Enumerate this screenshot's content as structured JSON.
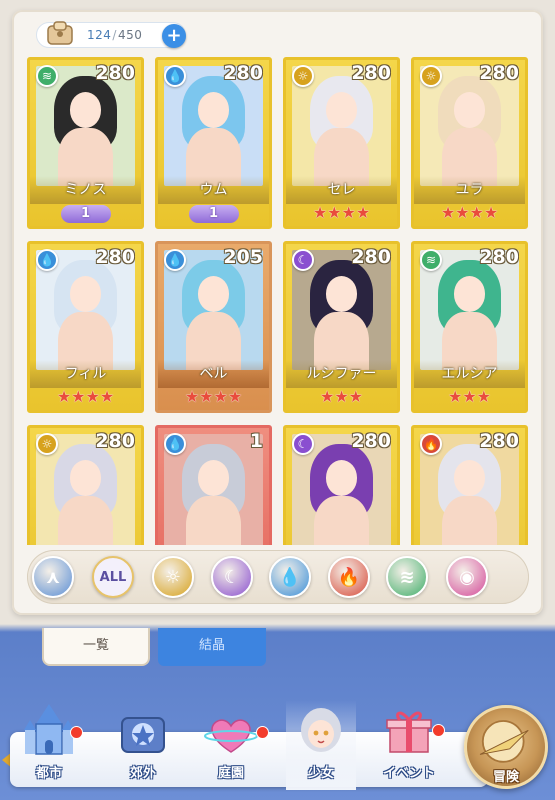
{
  "counter": {
    "current": "124",
    "separator": "/",
    "max": "450",
    "plus": "+"
  },
  "cards": [
    {
      "name": "ミノス",
      "level": "280",
      "element": "wind",
      "badge": "1",
      "stars": "",
      "frame": "gold",
      "hair": "#2a2a2a",
      "bg": "#dbe9c9",
      "elemColor": "#3fae6a",
      "elemGlyph": "≋"
    },
    {
      "name": "ウム",
      "level": "280",
      "element": "water",
      "badge": "1",
      "stars": "",
      "frame": "gold",
      "hair": "#7cc6ee",
      "bg": "#c9def6",
      "elemColor": "#3a8fd9",
      "elemGlyph": "💧"
    },
    {
      "name": "セレ",
      "level": "280",
      "element": "light",
      "badge": "",
      "stars": "★★★★",
      "frame": "gold",
      "hair": "#e8e8ef",
      "bg": "#f4e7a8",
      "elemColor": "#d7a21e",
      "elemGlyph": "☼"
    },
    {
      "name": "ユラ",
      "level": "280",
      "element": "light",
      "badge": "",
      "stars": "★★★★",
      "frame": "gold",
      "hair": "#f0dcbc",
      "bg": "#f5e9b7",
      "elemColor": "#d7a21e",
      "elemGlyph": "☼"
    },
    {
      "name": "フィル",
      "level": "280",
      "element": "water",
      "badge": "",
      "stars": "★★★★",
      "frame": "gold",
      "hair": "#d6e4f2",
      "bg": "#e5eef6",
      "elemColor": "#3a8fd9",
      "elemGlyph": "💧"
    },
    {
      "name": "ベル",
      "level": "205",
      "element": "water",
      "badge": "",
      "stars": "★★★★",
      "frame": "bronze",
      "hair": "#7ccbe8",
      "bg": "#b8d9ef",
      "elemColor": "#3a8fd9",
      "elemGlyph": "💧"
    },
    {
      "name": "ルシファー",
      "level": "280",
      "element": "dark",
      "badge": "",
      "stars": "★★★",
      "frame": "gold",
      "hair": "#2a2440",
      "bg": "#b7a98f",
      "elemColor": "#8a4fd0",
      "elemGlyph": "☾"
    },
    {
      "name": "エルシア",
      "level": "280",
      "element": "wind",
      "badge": "",
      "stars": "★★★",
      "frame": "gold",
      "hair": "#3fb58e",
      "bg": "#e6ebe6",
      "elemColor": "#3fae6a",
      "elemGlyph": "≋"
    },
    {
      "name": "",
      "level": "280",
      "element": "light",
      "badge": "",
      "stars": "",
      "frame": "gold",
      "hair": "#d8d8e6",
      "bg": "#f3e6b0",
      "elemColor": "#d7a21e",
      "elemGlyph": "☼"
    },
    {
      "name": "",
      "level": "1",
      "element": "water",
      "badge": "",
      "stars": "",
      "frame": "red",
      "hair": "#c8ccd8",
      "bg": "#e8b0a6",
      "elemColor": "#3a8fd9",
      "elemGlyph": "💧"
    },
    {
      "name": "",
      "level": "280",
      "element": "dark",
      "badge": "",
      "stars": "",
      "frame": "gold",
      "hair": "#7a3fb0",
      "bg": "#e9d7b6",
      "elemColor": "#8a4fd0",
      "elemGlyph": "☾"
    },
    {
      "name": "",
      "level": "280",
      "element": "fire",
      "badge": "",
      "stars": "",
      "frame": "gold",
      "hair": "#e4e4ec",
      "bg": "#f0d9a0",
      "elemColor": "#d74a3a",
      "elemGlyph": "🔥"
    }
  ],
  "filters": [
    {
      "id": "sort",
      "label": "",
      "color": "#5b8fd6",
      "glyph": "⋏",
      "icon": "sort-icon"
    },
    {
      "id": "all",
      "label": "ALL",
      "color": "#9b93c9",
      "glyph": "ALL",
      "icon": "all-filter-icon"
    },
    {
      "id": "light",
      "label": "",
      "color": "#d7a21e",
      "glyph": "☼",
      "icon": "light-element-icon"
    },
    {
      "id": "dark",
      "label": "",
      "color": "#8a4fd0",
      "glyph": "☾",
      "icon": "dark-element-icon"
    },
    {
      "id": "water",
      "label": "",
      "color": "#3a8fd9",
      "glyph": "💧",
      "icon": "water-element-icon"
    },
    {
      "id": "fire",
      "label": "",
      "color": "#d74a3a",
      "glyph": "🔥",
      "icon": "fire-element-icon"
    },
    {
      "id": "wind",
      "label": "",
      "color": "#3fae6a",
      "glyph": "≋",
      "icon": "wind-element-icon"
    },
    {
      "id": "special",
      "label": "",
      "color": "#d44a9a",
      "glyph": "◉",
      "icon": "special-element-icon"
    }
  ],
  "tabs": {
    "list": "一覧",
    "crystal": "結晶"
  },
  "nav": {
    "city": "都市",
    "suburb": "郊外",
    "garden": "庭園",
    "girls": "少女",
    "event": "イベント",
    "adventure": "冒険"
  }
}
